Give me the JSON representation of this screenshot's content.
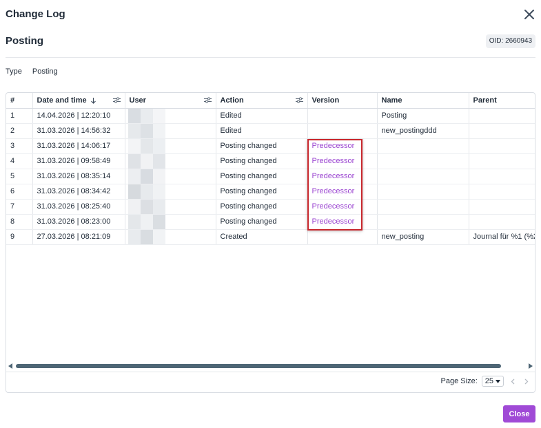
{
  "dialog": {
    "title": "Change Log",
    "close_icon": "close-icon"
  },
  "record": {
    "title": "Posting",
    "oid": "OID: 2660943"
  },
  "type_row": {
    "label": "Type",
    "value": "Posting"
  },
  "columns": {
    "index": "#",
    "date_time": "Date and time",
    "user": "User",
    "action": "Action",
    "version": "Version",
    "name": "Name",
    "parent": "Parent"
  },
  "rows": [
    {
      "index": "1",
      "date_time": "14.04.2026 | 12:20:10",
      "action": "Edited",
      "version": "",
      "name": "Posting",
      "parent": ""
    },
    {
      "index": "2",
      "date_time": "31.03.2026 | 14:56:32",
      "action": "Edited",
      "version": "",
      "name": "new_postingddd",
      "parent": ""
    },
    {
      "index": "3",
      "date_time": "31.03.2026 | 14:06:17",
      "action": "Posting changed",
      "version": "Predecessor",
      "name": "",
      "parent": ""
    },
    {
      "index": "4",
      "date_time": "31.03.2026 | 09:58:49",
      "action": "Posting changed",
      "version": "Predecessor",
      "name": "",
      "parent": ""
    },
    {
      "index": "5",
      "date_time": "31.03.2026 | 08:35:14",
      "action": "Posting changed",
      "version": "Predecessor",
      "name": "",
      "parent": ""
    },
    {
      "index": "6",
      "date_time": "31.03.2026 | 08:34:42",
      "action": "Posting changed",
      "version": "Predecessor",
      "name": "",
      "parent": ""
    },
    {
      "index": "7",
      "date_time": "31.03.2026 | 08:25:40",
      "action": "Posting changed",
      "version": "Predecessor",
      "name": "",
      "parent": ""
    },
    {
      "index": "8",
      "date_time": "31.03.2026 | 08:23:00",
      "action": "Posting changed",
      "version": "Predecessor",
      "name": "",
      "parent": ""
    },
    {
      "index": "9",
      "date_time": "27.03.2026 | 08:21:09",
      "action": "Created",
      "version": "",
      "name": "new_posting",
      "parent": "Journal für %1 (%2"
    }
  ],
  "pager": {
    "page_size_label": "Page Size:",
    "page_size_value": "25"
  },
  "footer": {
    "close_label": "Close"
  },
  "colors": {
    "accent": "#a04ad6",
    "link": "#9b45d1",
    "highlight_border": "#c8262c",
    "scroll_thumb": "#4e6675"
  }
}
